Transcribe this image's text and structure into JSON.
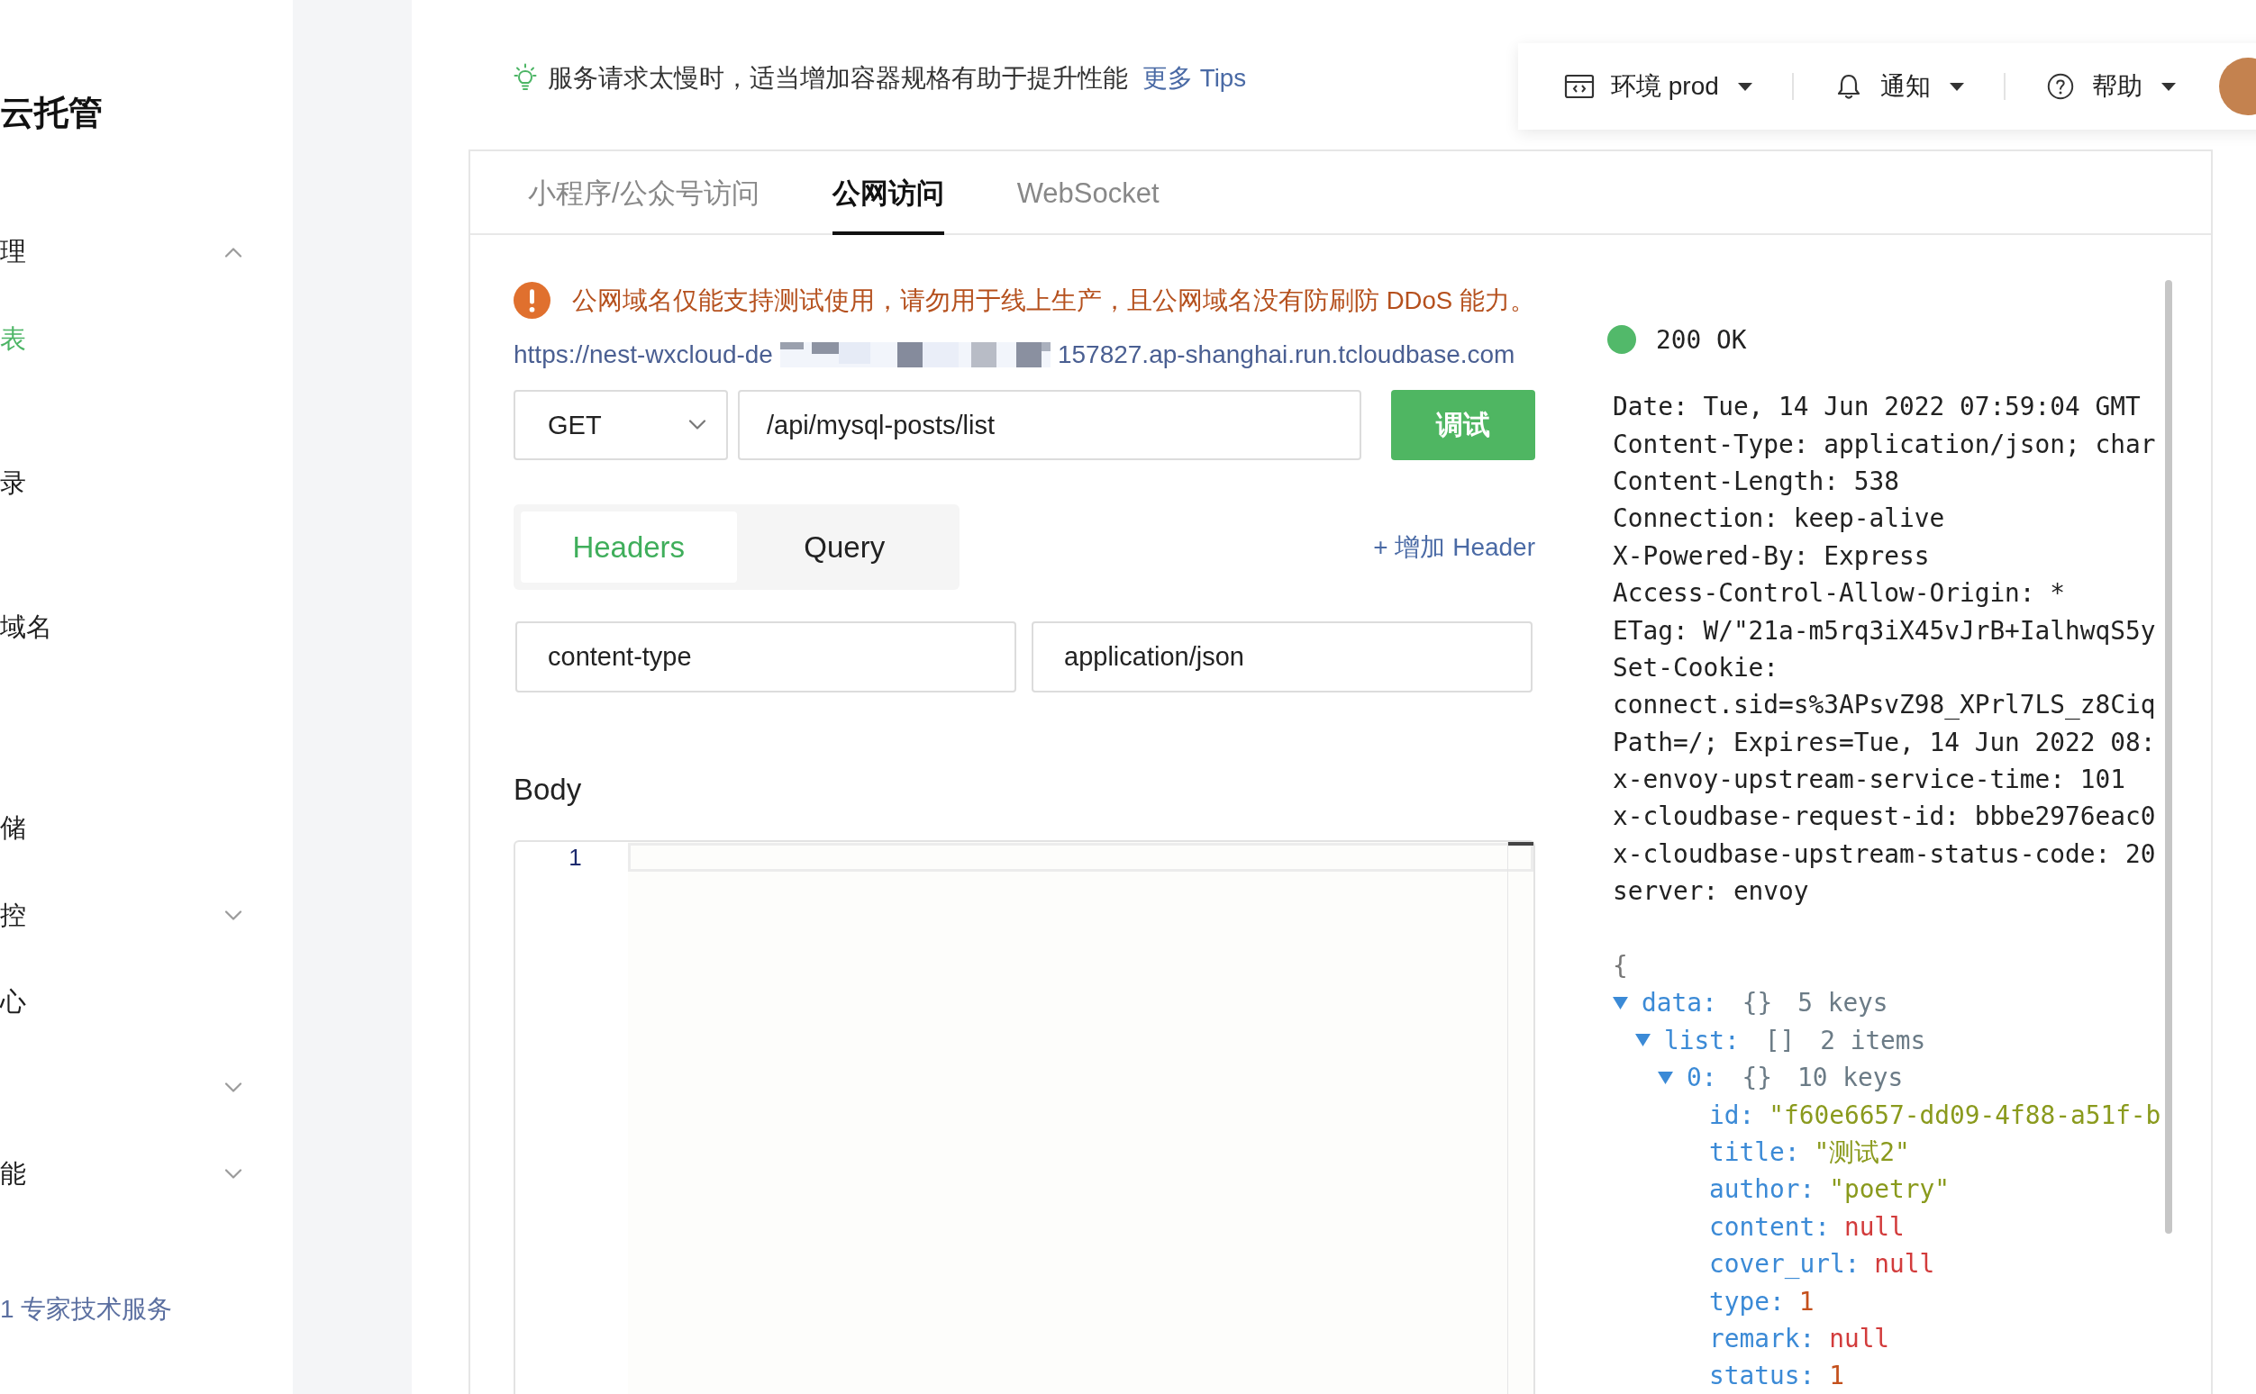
{
  "sidebar": {
    "title": "云托管",
    "items": [
      {
        "label": "理",
        "kind": "group",
        "expanded": true,
        "selected": false
      },
      {
        "label": "表",
        "kind": "link",
        "selected": true
      },
      {
        "label": "录",
        "kind": "link",
        "selected": false
      },
      {
        "label": "域名",
        "kind": "link",
        "selected": false
      },
      {
        "label": "储",
        "kind": "link",
        "selected": false
      },
      {
        "label": "控",
        "kind": "group",
        "expanded": false,
        "selected": false
      },
      {
        "label": "心",
        "kind": "link",
        "selected": false
      },
      {
        "kind": "group",
        "expanded": false,
        "selected": false
      },
      {
        "label": "能",
        "kind": "group",
        "expanded": false,
        "selected": false
      }
    ],
    "footer_link": "1 专家技术服务"
  },
  "topbar": {
    "tip": {
      "text": "服务请求太慢时，适当增加容器规格有助于提升性能",
      "link": "更多 Tips"
    },
    "menus": [
      {
        "kind": "environment",
        "label": "环境 prod"
      },
      {
        "kind": "notifications",
        "label": "通知"
      },
      {
        "kind": "help",
        "label": "帮助"
      }
    ]
  },
  "tabs": [
    {
      "label": "小程序/公众号访问",
      "selected": false
    },
    {
      "label": "公网访问",
      "selected": true
    },
    {
      "label": "WebSocket",
      "selected": false
    }
  ],
  "request": {
    "notice": "公网域名仅能支持测试使用，请勿用于线上生产，且公网域名没有防刷防 DDoS 能力。",
    "url": {
      "start": "https://nest-wxcloud-de",
      "end": "157827.ap-shanghai.run.tcloudbase.com"
    },
    "method": "GET",
    "path": "/api/mysql-posts/list",
    "send_button": "调试",
    "param_tabs": [
      {
        "label": "Headers",
        "selected": true
      },
      {
        "label": "Query",
        "selected": false
      }
    ],
    "add_header": "+ 增加 Header",
    "headers": [
      {
        "key": "content-type",
        "value": "application/json"
      }
    ],
    "body": {
      "label": "Body",
      "lines": [
        {
          "number": "1",
          "current": true
        }
      ]
    }
  },
  "response": {
    "status": {
      "text": "200 OK",
      "ok": true
    },
    "headers": [
      "Date: Tue, 14 Jun 2022 07:59:04 GMT",
      "Content-Type: application/json; char",
      "Content-Length: 538",
      "Connection: keep-alive",
      "X-Powered-By: Express",
      "Access-Control-Allow-Origin: *",
      "ETag: W/\"21a-m5rq3iX45vJrB+IalhwqS5y",
      "Set-Cookie:",
      "connect.sid=s%3APsvZ98_XPrl7LS_z8Ciq",
      "Path=/; Expires=Tue, 14 Jun 2022 08:",
      "x-envoy-upstream-service-time: 101",
      "x-cloudbase-request-id: bbbe2976eac0",
      "x-cloudbase-upstream-status-code: 20",
      "server: envoy"
    ],
    "body": {
      "open_brace": "{",
      "tree": [
        {
          "key": "data:",
          "kind": "object",
          "type_mark": "{}",
          "summary": "5 keys",
          "expanded": true,
          "children": [
            {
              "key": "list:",
              "kind": "array",
              "type_mark": "[]",
              "summary": "2 items",
              "expanded": true,
              "children": [
                {
                  "key": "0:",
                  "kind": "object",
                  "type_mark": "{}",
                  "summary": "10 keys",
                  "expanded": true,
                  "children": [
                    {
                      "key": "id:",
                      "kind": "string",
                      "value": "\"f60e6657-dd09-4f88-a51f-b"
                    },
                    {
                      "key": "title:",
                      "kind": "string",
                      "value": "\"测试2\""
                    },
                    {
                      "key": "author:",
                      "kind": "string",
                      "value": "\"poetry\""
                    },
                    {
                      "key": "content:",
                      "kind": "null",
                      "value": "null"
                    },
                    {
                      "key": "cover_url:",
                      "kind": "null",
                      "value": "null"
                    },
                    {
                      "key": "type:",
                      "kind": "number",
                      "value": "1"
                    },
                    {
                      "key": "remark:",
                      "kind": "null",
                      "value": "null"
                    },
                    {
                      "key": "status:",
                      "kind": "number",
                      "value": "1"
                    }
                  ]
                }
              ]
            }
          ]
        }
      ]
    }
  }
}
